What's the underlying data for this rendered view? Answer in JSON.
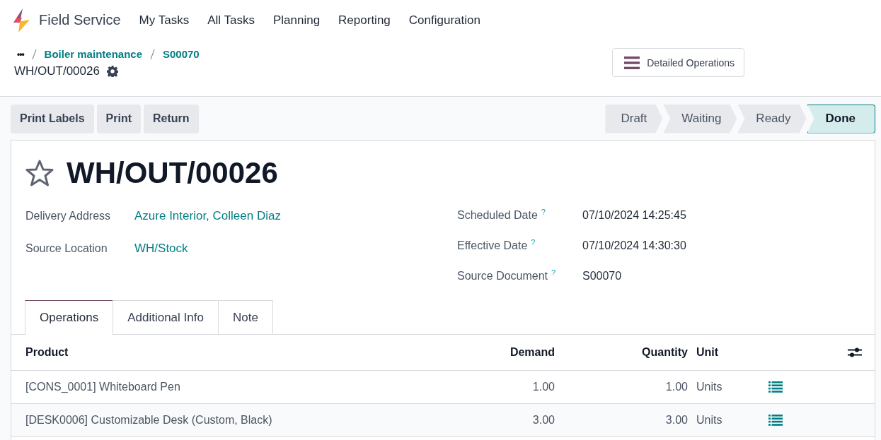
{
  "app": {
    "name": "Field Service"
  },
  "menu": [
    "My Tasks",
    "All Tasks",
    "Planning",
    "Reporting",
    "Configuration"
  ],
  "breadcrumbs": {
    "ellipsis": "•••",
    "items": [
      "Boiler maintenance",
      "S00070"
    ],
    "current": "WH/OUT/00026"
  },
  "detailed_operations_button": "Detailed Operations",
  "actions": [
    "Print Labels",
    "Print",
    "Return"
  ],
  "stages": [
    {
      "label": "Draft",
      "selected": false
    },
    {
      "label": "Waiting",
      "selected": false
    },
    {
      "label": "Ready",
      "selected": false
    },
    {
      "label": "Done",
      "selected": true
    }
  ],
  "record": {
    "title": "WH/OUT/00026",
    "starred": false
  },
  "left_fields": [
    {
      "label": "Delivery Address",
      "value": "Azure Interior, Colleen Diaz",
      "kind": "link"
    },
    {
      "label": "Source Location",
      "value": "WH/Stock",
      "kind": "link"
    }
  ],
  "right_fields": [
    {
      "label": "Scheduled Date",
      "help": "?",
      "value": "07/10/2024 14:25:45",
      "kind": "text"
    },
    {
      "label": "Effective Date",
      "help": "?",
      "value": "07/10/2024 14:30:30",
      "kind": "text"
    },
    {
      "label": "Source Document",
      "help": "?",
      "value": "S00070",
      "kind": "text"
    }
  ],
  "tabs": [
    {
      "label": "Operations",
      "selected": true
    },
    {
      "label": "Additional Info",
      "selected": false
    },
    {
      "label": "Note",
      "selected": false
    }
  ],
  "table": {
    "columns": [
      "Product",
      "Demand",
      "Quantity",
      "Unit"
    ],
    "rows": [
      {
        "product": "[CONS_0001] Whiteboard Pen",
        "demand": "1.00",
        "quantity": "1.00",
        "unit": "Units"
      },
      {
        "product": "[DESK0006] Customizable Desk (Custom, Black)",
        "demand": "3.00",
        "quantity": "3.00",
        "unit": "Units"
      }
    ]
  }
}
